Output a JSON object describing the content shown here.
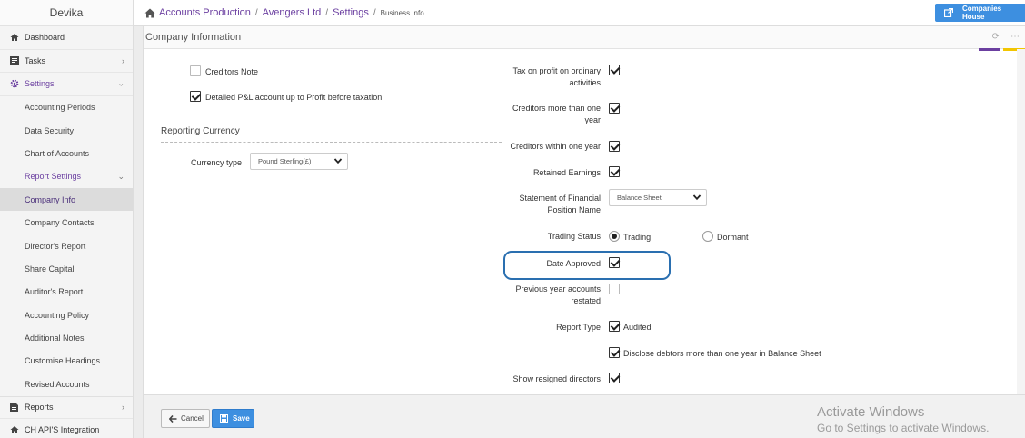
{
  "sidebar": {
    "brand": "Devika",
    "items": [
      {
        "label": "Dashboard"
      },
      {
        "label": "Tasks"
      },
      {
        "label": "Settings"
      }
    ],
    "settings_sub": [
      {
        "label": "Accounting Periods"
      },
      {
        "label": "Data Security"
      },
      {
        "label": "Chart of Accounts"
      },
      {
        "label": "Report Settings"
      },
      {
        "label": "Company Info"
      },
      {
        "label": "Company Contacts"
      },
      {
        "label": "Director's Report"
      },
      {
        "label": "Share Capital"
      },
      {
        "label": "Auditor's Report"
      },
      {
        "label": "Accounting Policy"
      },
      {
        "label": "Additional Notes"
      },
      {
        "label": "Customise Headings"
      },
      {
        "label": "Revised Accounts"
      }
    ],
    "bottom_items": [
      {
        "label": "Reports"
      },
      {
        "label": "CH API'S Integration"
      }
    ]
  },
  "breadcrumb": {
    "c1": "Accounts Production",
    "c2": "Avengers Ltd",
    "c3": "Settings",
    "c4": "Business Info.",
    "sep": "/"
  },
  "companies_house_button": "Companies House",
  "panel": {
    "title": "Company Information"
  },
  "left_form": {
    "creditors_note": "Creditors Note",
    "detailed_pl": "Detailed P&L account up to Profit before taxation",
    "reporting_currency": "Reporting Currency",
    "currency_type_label": "Currency type",
    "currency_value": "Pound Sterling(£)"
  },
  "right_form": {
    "tax_on_profit_1": "Tax on profit on ordinary",
    "tax_on_profit_2": "activities",
    "creditors_more_1": "Creditors more than one",
    "creditors_more_2": "year",
    "creditors_within": "Creditors within one year",
    "retained_earnings": "Retained Earnings",
    "sofp_1": "Statement of Financial",
    "sofp_2": "Position Name",
    "sofp_value": "Balance Sheet",
    "trading_status": "Trading Status",
    "trading": "Trading",
    "dormant": "Dormant",
    "date_approved": "Date Approved",
    "prev_year_1": "Previous year accounts",
    "prev_year_2": "restated",
    "report_type": "Report Type",
    "audited": "Audited",
    "disclose_debtors": "Disclose debtors more than one year in Balance Sheet",
    "show_resigned": "Show resigned directors"
  },
  "footer": {
    "cancel": "Cancel",
    "save": "Save"
  },
  "watermark": {
    "line1": "Activate Windows",
    "line2": "Go to Settings to activate Windows."
  },
  "colors": {
    "accent_purple": "#6b3fa0",
    "primary_blue": "#3d8fe0",
    "highlight_blue": "#2a6fb0"
  }
}
